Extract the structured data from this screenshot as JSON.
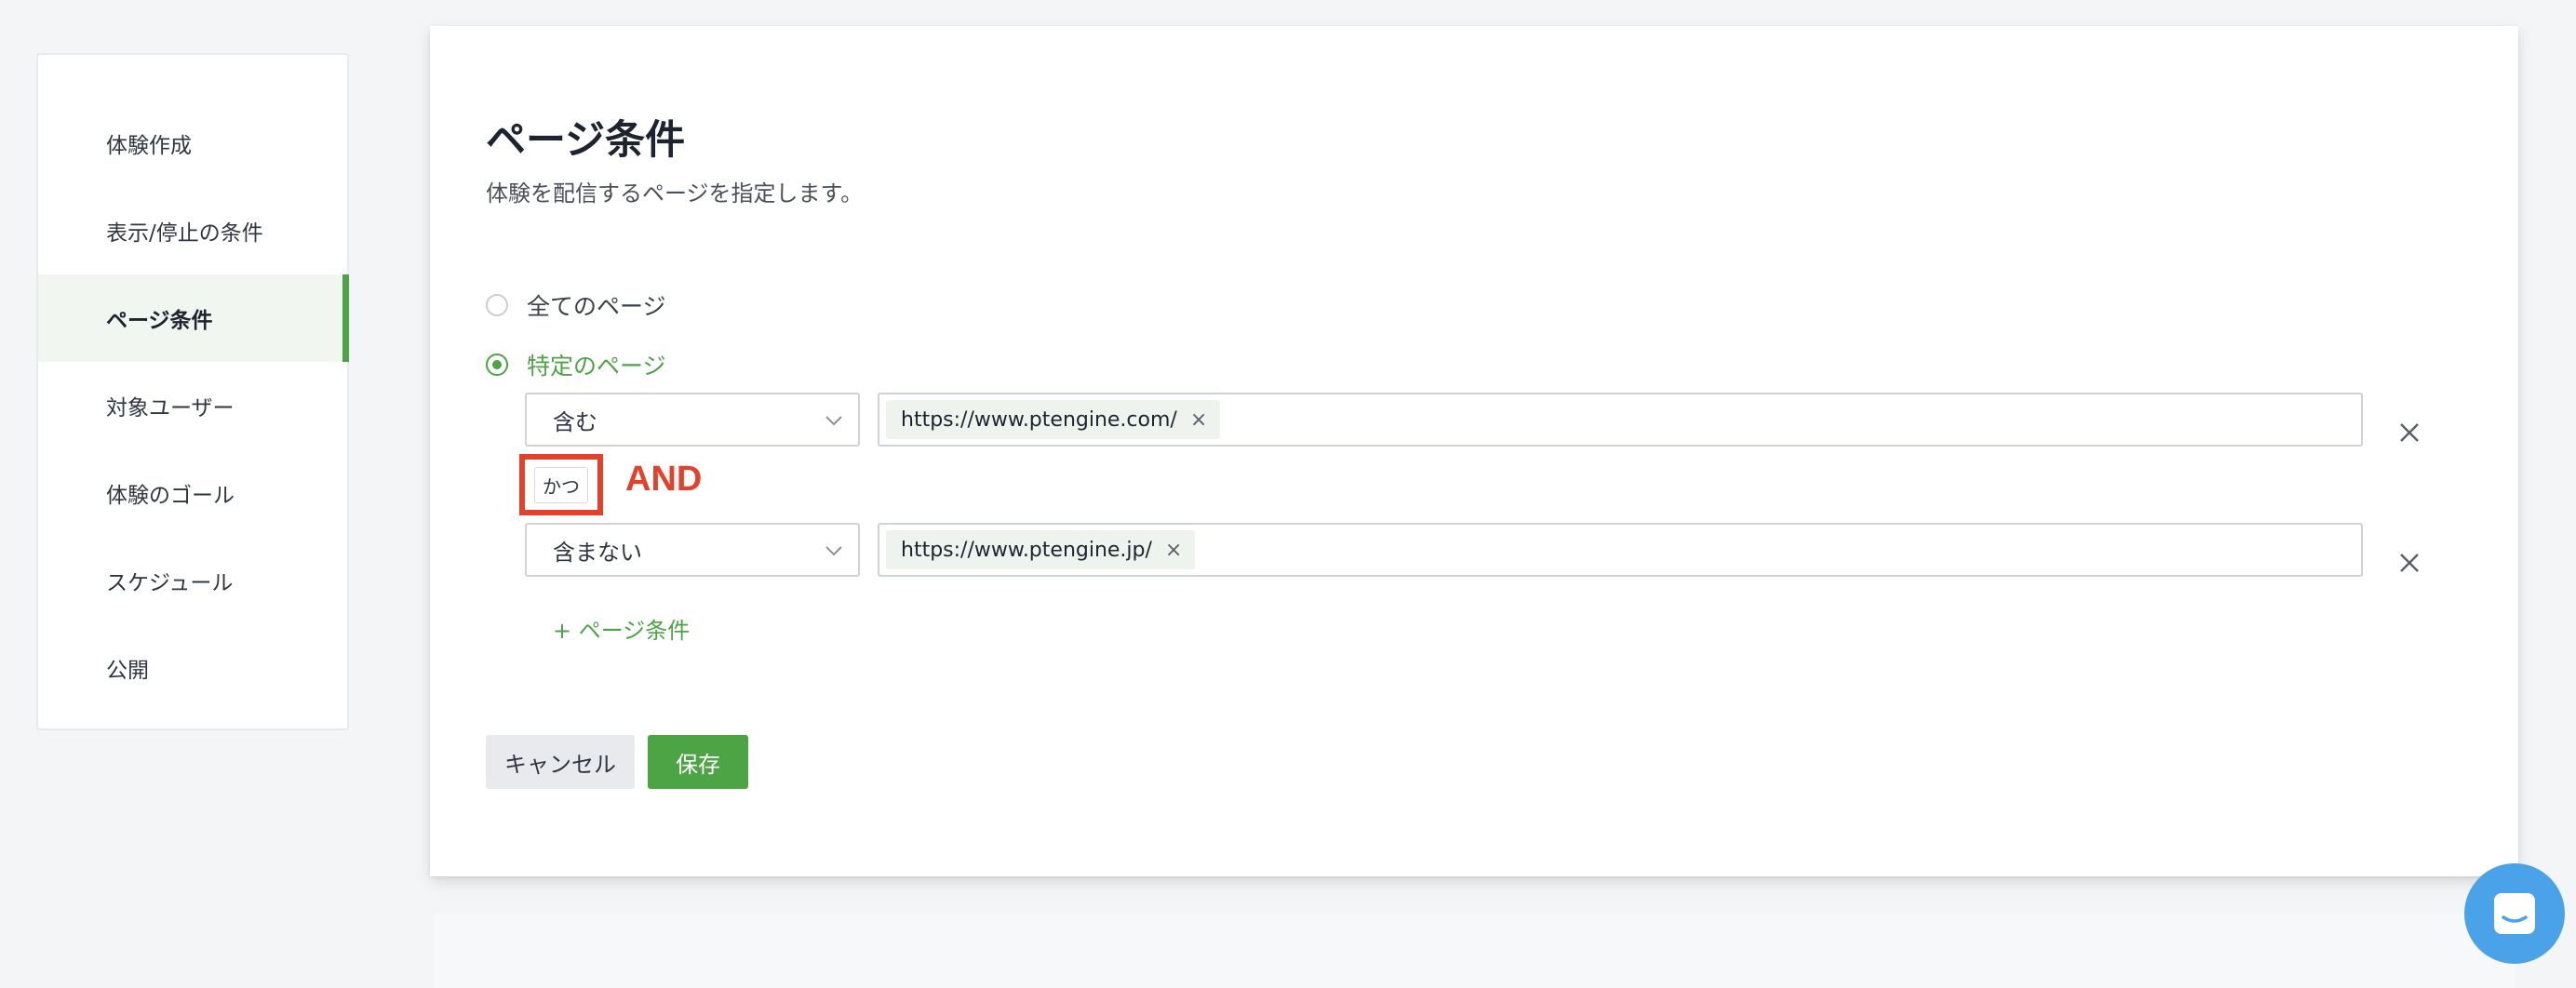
{
  "sidebar": {
    "items": [
      {
        "label": "体験作成"
      },
      {
        "label": "表示/停止の条件"
      },
      {
        "label": "ページ条件"
      },
      {
        "label": "対象ユーザー"
      },
      {
        "label": "体験のゴール"
      },
      {
        "label": "スケジュール"
      },
      {
        "label": "公開"
      }
    ],
    "active_index": 2
  },
  "main": {
    "title": "ページ条件",
    "subtitle": "体験を配信するページを指定します。",
    "radio_all": "全てのページ",
    "radio_specific": "特定のページ",
    "selected": "特定のページ",
    "conditions": [
      {
        "operator": "含む",
        "tag": "https://www.ptengine.com/"
      },
      {
        "operator": "含まない",
        "tag": "https://www.ptengine.jp/"
      }
    ],
    "and_chip": "かつ",
    "and_annotation": "AND",
    "add_condition": "+ ページ条件",
    "cancel_label": "キャンセル",
    "save_label": "保存"
  },
  "colors": {
    "accent": "#4ca444",
    "annotation": "#e2412c",
    "chat": "#4aa3e8"
  }
}
